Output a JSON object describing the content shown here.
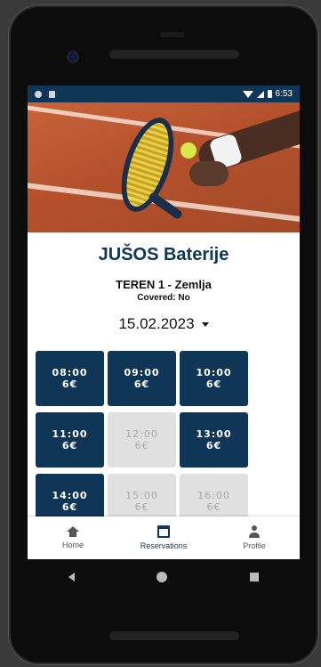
{
  "status_bar": {
    "time": "6:53"
  },
  "venue": {
    "name": "JUŠOS Baterije",
    "court": "TEREN 1 - Zemlja",
    "covered": "Covered: No",
    "date": "15.02.2023"
  },
  "slots": [
    {
      "time": "08:00",
      "price": "6€",
      "available": true
    },
    {
      "time": "09:00",
      "price": "6€",
      "available": true
    },
    {
      "time": "10:00",
      "price": "6€",
      "available": true
    },
    {
      "time": "11:00",
      "price": "6€",
      "available": true
    },
    {
      "time": "12:00",
      "price": "6€",
      "available": false
    },
    {
      "time": "13:00",
      "price": "6€",
      "available": true
    },
    {
      "time": "14:00",
      "price": "6€",
      "available": true
    },
    {
      "time": "15:00",
      "price": "6€",
      "available": false
    },
    {
      "time": "16:00",
      "price": "6€",
      "available": false
    }
  ],
  "nav": {
    "home": "Home",
    "reservations": "Reservations",
    "profile": "Profile",
    "active": "reservations"
  },
  "colors": {
    "primary": "#0f3557",
    "slot_taken": "#e0e0e0",
    "court_clay": "#b4512c"
  }
}
